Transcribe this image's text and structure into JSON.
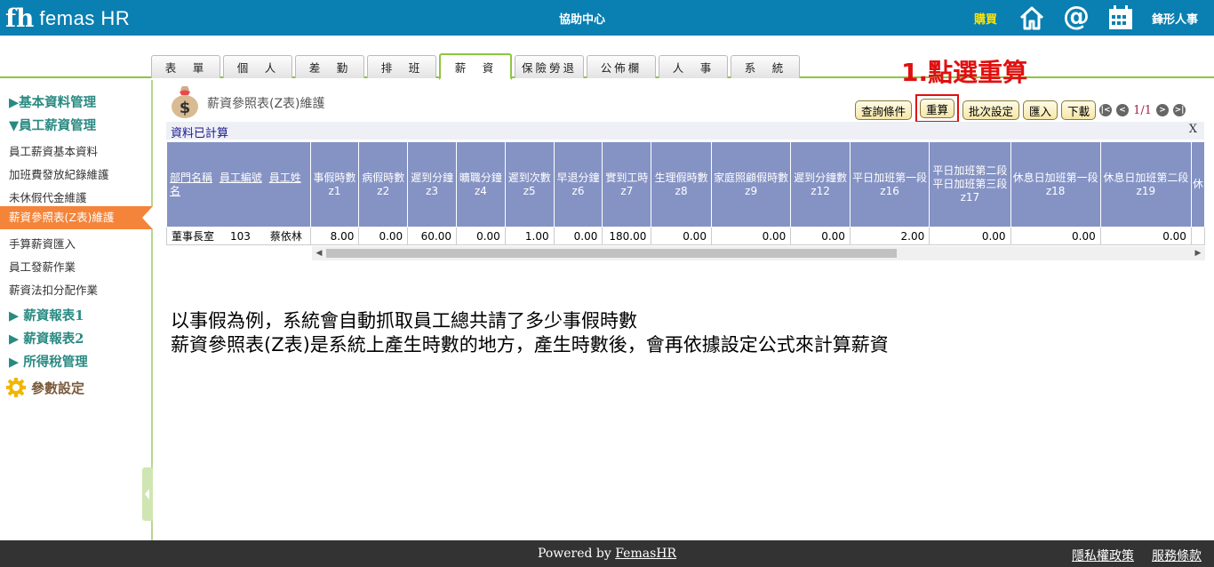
{
  "header": {
    "logo_mark": "fh",
    "logo_text": "femas HR",
    "help_center": "協助中心",
    "buy": "購買",
    "company": "鋒形人事",
    "icons": [
      "home-icon",
      "at-icon",
      "calendar-icon"
    ]
  },
  "tabs": [
    {
      "label": "表　單",
      "active": false
    },
    {
      "label": "個　人",
      "active": false
    },
    {
      "label": "差　勤",
      "active": false
    },
    {
      "label": "排　班",
      "active": false
    },
    {
      "label": "薪　資",
      "active": true
    },
    {
      "label": "保險勞退",
      "active": false
    },
    {
      "label": "公佈欄",
      "active": false
    },
    {
      "label": "人　事",
      "active": false
    },
    {
      "label": "系　統",
      "active": false
    }
  ],
  "annotation": "1.點選重算",
  "sidebar": {
    "head_basic": "▶基本資料管理",
    "head_salary": "▼員工薪資管理",
    "items": [
      "員工薪資基本資料",
      "加班費發放紀錄維護",
      "未休假代金維護",
      "薪資參照表(Z表)維護",
      "手算薪資匯入",
      "員工發薪作業",
      "薪資法扣分配作業"
    ],
    "active_index": 3,
    "head_report1": "▶ 薪資報表1",
    "head_report2": "▶ 薪資報表2",
    "head_tax": "▶ 所得稅管理",
    "param": "參數設定"
  },
  "main": {
    "title": "薪資參照表(Z表)維護",
    "buttons": {
      "query": "查詢條件",
      "recalc": "重算",
      "batch": "批次設定",
      "import": "匯入",
      "download": "下載"
    },
    "page_info": "1/1",
    "status": "資料已計算",
    "close": "X"
  },
  "table": {
    "link_headers": [
      "部門名稱",
      "員工編號",
      "員工姓名"
    ],
    "columns": [
      {
        "name": "事假時數",
        "code": "z1"
      },
      {
        "name": "病假時數",
        "code": "z2"
      },
      {
        "name": "遲到分鐘",
        "code": "z3"
      },
      {
        "name": "曠職分鐘",
        "code": "z4"
      },
      {
        "name": "遲到次數",
        "code": "z5"
      },
      {
        "name": "早退分鐘",
        "code": "z6"
      },
      {
        "name": "實到工時",
        "code": "z7"
      },
      {
        "name": "生理假時數",
        "code": "z8"
      },
      {
        "name": "家庭照顧假時數",
        "code": "z9"
      },
      {
        "name": "遲到分鐘數",
        "code": "z12"
      },
      {
        "name": "平日加班第一段",
        "code": "z16"
      },
      {
        "name": "平日加班第二段\n平日加班第三段",
        "code": "z17"
      },
      {
        "name": "休息日加班第一段",
        "code": "z18"
      },
      {
        "name": "休息日加班第二段",
        "code": "z19"
      },
      {
        "name": "休",
        "code": ""
      }
    ],
    "rows": [
      {
        "dept": "董事長室",
        "emp_no": "103",
        "emp_name": "蔡依林",
        "values": [
          "8.00",
          "0.00",
          "60.00",
          "0.00",
          "1.00",
          "0.00",
          "180.00",
          "0.00",
          "0.00",
          "0.00",
          "2.00",
          "0.00",
          "0.00",
          "0.00",
          ""
        ]
      }
    ]
  },
  "description": {
    "line1": "以事假為例，系統會自動抓取員工總共請了多少事假時數",
    "line2": "薪資參照表(Z表)是系統上產生時數的地方，產生時數後，會再依據設定公式來計算薪資"
  },
  "footer": {
    "powered_prefix": "Powered by ",
    "powered_link": "FemasHR",
    "privacy": "隱私權政策",
    "terms": "服務條款"
  }
}
